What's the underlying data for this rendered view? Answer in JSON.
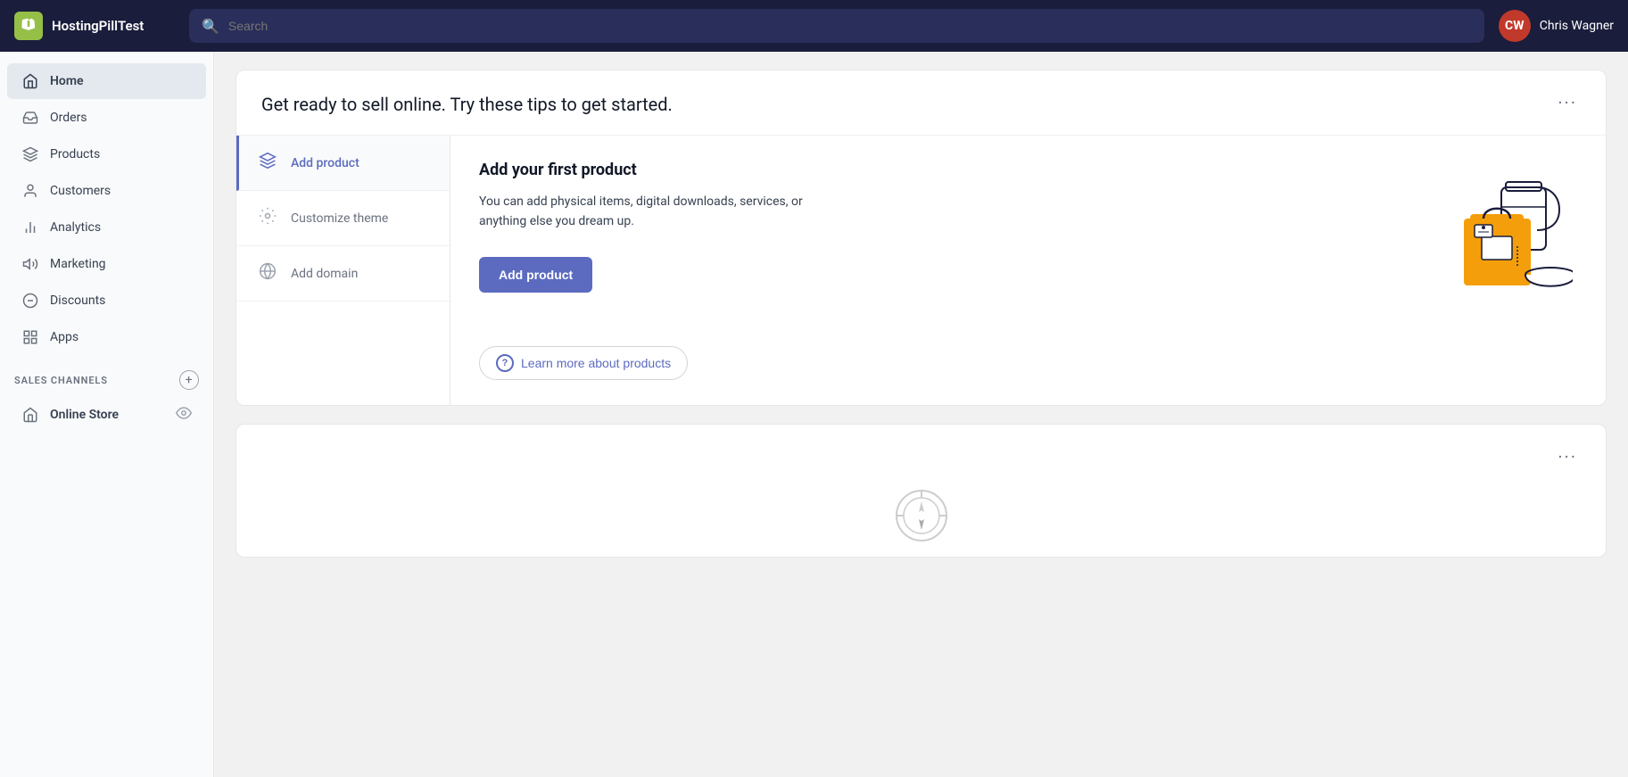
{
  "brand": {
    "name": "HostingPillTest",
    "logo_letter": "S"
  },
  "search": {
    "placeholder": "Search"
  },
  "user": {
    "initials": "CW",
    "name": "Chris Wagner"
  },
  "sidebar": {
    "main_items": [
      {
        "id": "home",
        "label": "Home",
        "icon": "🏠",
        "active": true
      },
      {
        "id": "orders",
        "label": "Orders",
        "icon": "📥",
        "active": false
      },
      {
        "id": "products",
        "label": "Products",
        "icon": "🏷️",
        "active": false
      },
      {
        "id": "customers",
        "label": "Customers",
        "icon": "👤",
        "active": false
      },
      {
        "id": "analytics",
        "label": "Analytics",
        "icon": "📊",
        "active": false
      },
      {
        "id": "marketing",
        "label": "Marketing",
        "icon": "📢",
        "active": false
      },
      {
        "id": "discounts",
        "label": "Discounts",
        "icon": "🎫",
        "active": false
      },
      {
        "id": "apps",
        "label": "Apps",
        "icon": "⊞",
        "active": false
      }
    ],
    "sales_channels_label": "SALES CHANNELS",
    "online_store_label": "Online Store"
  },
  "main_card": {
    "title": "Get ready to sell online. Try these tips to get started.",
    "more_label": "···",
    "tips": [
      {
        "id": "add-product",
        "label": "Add product",
        "icon": "🏷️",
        "active": true
      },
      {
        "id": "customize-theme",
        "label": "Customize theme",
        "icon": "✏️",
        "active": false
      },
      {
        "id": "add-domain",
        "label": "Add domain",
        "icon": "🌐",
        "active": false
      }
    ],
    "detail": {
      "title": "Add your first product",
      "description": "You can add physical items, digital downloads, services, or anything else you dream up.",
      "cta_label": "Add product",
      "learn_more_label": "Learn more about products",
      "learn_more_icon": "?"
    }
  },
  "second_card": {
    "more_label": "···"
  }
}
